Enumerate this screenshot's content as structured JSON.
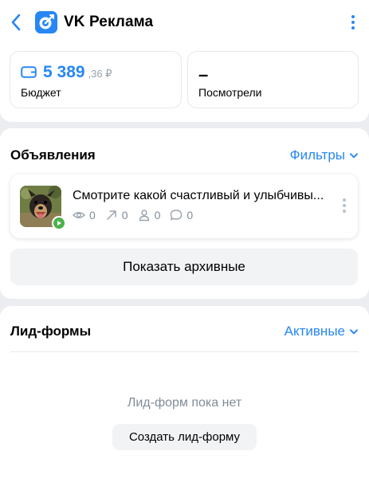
{
  "header": {
    "title": "VK Реклама",
    "back_icon": "chevron-left-icon",
    "more_icon": "more-vertical-icon",
    "accent": "#2787f5"
  },
  "stats": {
    "budget": {
      "value": "5 389",
      "fraction": ",36 ₽",
      "label": "Бюджет",
      "icon": "wallet-icon"
    },
    "views": {
      "value": "–",
      "label": "Посмотрели"
    }
  },
  "ads": {
    "title": "Объявления",
    "filter_label": "Фильтры",
    "items": [
      {
        "title": "Смотрите какой счастливый и улыбчивы...",
        "metrics": [
          {
            "icon": "eye-icon",
            "value": "0"
          },
          {
            "icon": "arrow-up-right-icon",
            "value": "0"
          },
          {
            "icon": "user-icon",
            "value": "0"
          },
          {
            "icon": "comment-icon",
            "value": "0"
          }
        ]
      }
    ],
    "archive_button": "Показать архивные"
  },
  "lead_forms": {
    "title": "Лид-формы",
    "filter_label": "Активные",
    "empty_text": "Лид-форм пока нет",
    "create_button": "Создать лид-форму"
  }
}
